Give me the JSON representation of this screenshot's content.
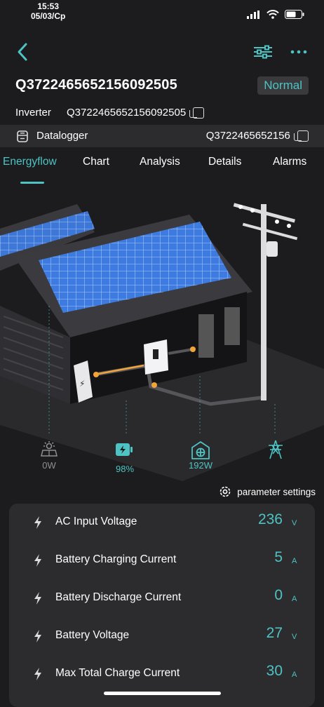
{
  "status_bar": {
    "time": "15:53",
    "date": "05/03/Ср"
  },
  "header": {
    "device_id": "Q3722465652156092505",
    "state_badge": "Normal"
  },
  "inverter": {
    "label": "Inverter",
    "serial": "Q3722465652156092505"
  },
  "datalogger": {
    "label": "Datalogger",
    "serial": "Q3722465652156"
  },
  "tabs": [
    "Energyflow",
    "Chart",
    "Analysis",
    "Details",
    "Alarms"
  ],
  "active_tab": "Energyflow",
  "energyflow": {
    "solar": {
      "value": "0W",
      "icon": "solar-panel-icon"
    },
    "battery": {
      "value": "98%",
      "icon": "battery-charging-icon"
    },
    "load": {
      "value": "192W",
      "icon": "home-load-icon"
    },
    "grid": {
      "icon": "power-tower-icon"
    }
  },
  "parameter_settings": "parameter settings",
  "parameters": [
    {
      "label": "AC Input Voltage",
      "value": "236",
      "unit": "V"
    },
    {
      "label": "Battery Charging Current",
      "value": "5",
      "unit": "A"
    },
    {
      "label": "Battery Discharge Current",
      "value": "0",
      "unit": "A"
    },
    {
      "label": "Battery Voltage",
      "value": "27",
      "unit": "V"
    },
    {
      "label": "Max Total Charge Current",
      "value": "30",
      "unit": "A"
    }
  ],
  "colors": {
    "accent": "#4ec3c3",
    "background": "#1c1c1e",
    "card": "#2c2c2e"
  }
}
